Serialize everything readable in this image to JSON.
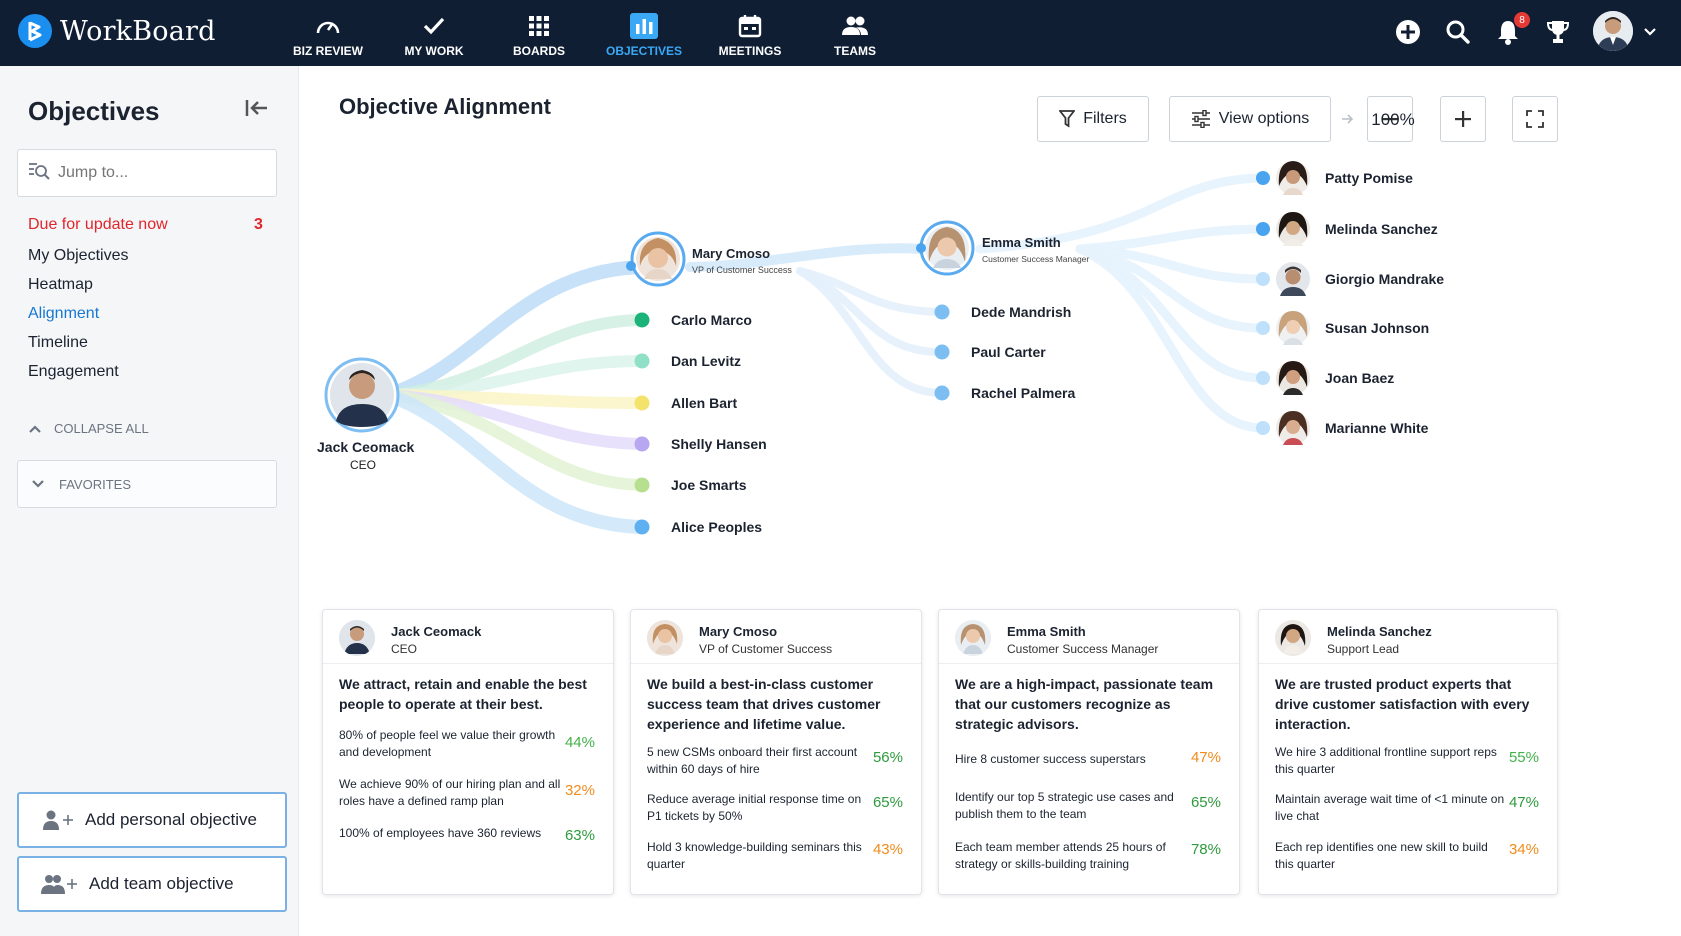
{
  "app": {
    "name": "WorkBoard"
  },
  "nav": [
    {
      "label": "BIZ REVIEW",
      "icon": "gauge-icon"
    },
    {
      "label": "MY WORK",
      "icon": "check-icon"
    },
    {
      "label": "BOARDS",
      "icon": "grid-icon"
    },
    {
      "label": "OBJECTIVES",
      "icon": "bar-chart-icon",
      "active": true
    },
    {
      "label": "MEETINGS",
      "icon": "calendar-icon"
    },
    {
      "label": "TEAMS",
      "icon": "people-icon"
    }
  ],
  "header_right": {
    "notifications_count": "8",
    "icons": [
      "add-icon",
      "search-icon",
      "bell-icon",
      "trophy-icon",
      "user-avatar",
      "chevron-down-icon"
    ]
  },
  "sidebar": {
    "title": "Objectives",
    "search_placeholder": "Jump to...",
    "links": [
      {
        "label": "Due for update now",
        "count": "3",
        "style": "alert"
      },
      {
        "label": "My Objectives"
      },
      {
        "label": "Heatmap"
      },
      {
        "label": "Alignment",
        "style": "active"
      },
      {
        "label": "Timeline"
      },
      {
        "label": "Engagement"
      }
    ],
    "collapse_all": "COLLAPSE ALL",
    "favorites": "FAVORITES",
    "add_personal": "Add personal objective",
    "add_team": "Add team objective"
  },
  "main": {
    "title": "Objective Alignment",
    "filters_label": "Filters",
    "view_options_label": "View options",
    "zoom": "100%"
  },
  "tree": {
    "root": {
      "name": "Jack Ceomack",
      "role": "CEO"
    },
    "vp": {
      "name": "Mary Cmoso",
      "role": "VP of Customer Success"
    },
    "level1": [
      {
        "name": "Carlo Marco",
        "color": "#1bb37a"
      },
      {
        "name": "Dan Levitz",
        "color": "#8fe0c6"
      },
      {
        "name": "Allen Bart",
        "color": "#f4e36b"
      },
      {
        "name": "Shelly Hansen",
        "color": "#b7a6f0"
      },
      {
        "name": "Joe Smarts",
        "color": "#b6e08f"
      },
      {
        "name": "Alice Peoples",
        "color": "#5fb0f0"
      }
    ],
    "manager": {
      "name": "Emma Smith",
      "role": "Customer Success Manager"
    },
    "level2": [
      {
        "name": "Dede Mandrish",
        "color": "#7cbdf2"
      },
      {
        "name": "Paul Carter",
        "color": "#7cbdf2"
      },
      {
        "name": "Rachel Palmera",
        "color": "#7cbdf2"
      }
    ],
    "level3": [
      {
        "name": "Patty Pomise",
        "color": "#4aa3ef"
      },
      {
        "name": "Melinda Sanchez",
        "color": "#4aa3ef"
      },
      {
        "name": "Giorgio Mandrake",
        "color": "#bfe0fb"
      },
      {
        "name": "Susan Johnson",
        "color": "#bfe0fb"
      },
      {
        "name": "Joan Baez",
        "color": "#bfe0fb"
      },
      {
        "name": "Marianne White",
        "color": "#bfe0fb"
      }
    ]
  },
  "cards": [
    {
      "name": "Jack Ceomack",
      "role": "CEO",
      "objective": "We attract, retain and enable the best people to operate at their best.",
      "results": [
        {
          "text": "80% of people feel we value their growth and development",
          "pct": "44%",
          "color": "#43b049"
        },
        {
          "text": "We achieve 90% of our hiring plan and all roles have a defined ramp plan",
          "pct": "32%",
          "color": "#f08b1c"
        },
        {
          "text": "100% of employees have 360 reviews",
          "pct": "63%",
          "color": "#2e9a3e"
        }
      ]
    },
    {
      "name": "Mary Cmoso",
      "role": "VP of Customer Success",
      "objective": "We build a best-in-class customer success team that drives customer experience and lifetime value.",
      "results": [
        {
          "text": "5 new CSMs onboard their first account within 60 days of hire",
          "pct": "56%",
          "color": "#2e9a3e"
        },
        {
          "text": "Reduce average initial response time on P1 tickets by 50%",
          "pct": "65%",
          "color": "#2e9a3e"
        },
        {
          "text": "Hold 3 knowledge-building seminars this quarter",
          "pct": "43%",
          "color": "#f08b1c"
        }
      ]
    },
    {
      "name": "Emma Smith",
      "role": "Customer Success Manager",
      "objective": "We are a high-impact, passionate team that our customers recognize as strategic advisors.",
      "results": [
        {
          "text": "Hire 8 customer success superstars",
          "pct": "47%",
          "color": "#f08b1c"
        },
        {
          "text": "Identify our top 5 strategic use cases and publish them to the team",
          "pct": "65%",
          "color": "#2e9a3e"
        },
        {
          "text": "Each team member attends 25 hours of strategy or skills-building training",
          "pct": "78%",
          "color": "#2e9a3e"
        }
      ]
    },
    {
      "name": "Melinda Sanchez",
      "role": "Support Lead",
      "objective": "We are trusted product experts that drive customer satisfaction with every interaction.",
      "results": [
        {
          "text": "We hire 3 additional frontline support reps this quarter",
          "pct": "55%",
          "color": "#43b049"
        },
        {
          "text": "Maintain average wait time of <1 minute on live chat",
          "pct": "47%",
          "color": "#2e9a3e"
        },
        {
          "text": "Each rep identifies one new skill to build this quarter",
          "pct": "34%",
          "color": "#f08b1c"
        }
      ]
    }
  ]
}
